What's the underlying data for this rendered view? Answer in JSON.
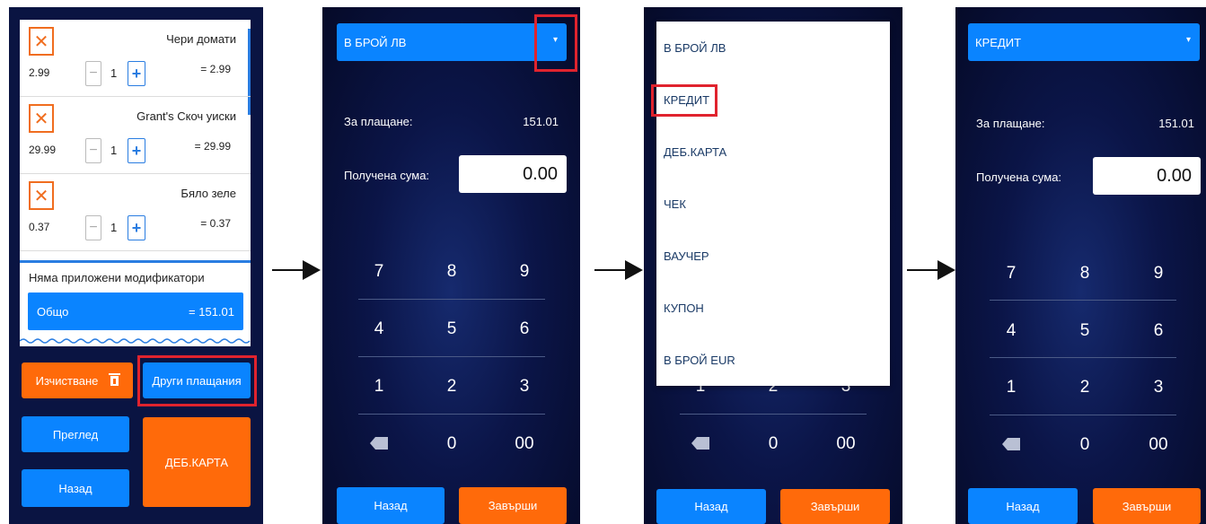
{
  "screen1": {
    "items": [
      {
        "name": "Чери домати",
        "price": "2.99",
        "qty": "1",
        "total": "= 2.99"
      },
      {
        "name": "Grant's Скоч уиски",
        "price": "29.99",
        "qty": "1",
        "total": "= 29.99"
      },
      {
        "name": "Бяло зеле",
        "price": "0.37",
        "qty": "1",
        "total": "= 0.37"
      }
    ],
    "remove_glyph": "✕",
    "minus_glyph": "−",
    "plus_glyph": "+",
    "modifiers_text": "Няма приложени модификатори",
    "total_label": "Общо",
    "total_value": "= 151.01",
    "clear_label": "Изчистване",
    "other_payments_label": "Други плащания",
    "preview_label": "Преглед",
    "back_label": "Назад",
    "debit_card_label": "ДЕБ.КАРТА"
  },
  "screen2": {
    "payment_method": "В БРОЙ ЛВ",
    "to_pay_label": "За плащане:",
    "to_pay_value": "151.01",
    "received_label": "Получена сума:",
    "received_value": "0.00",
    "back_label": "Назад",
    "finish_label": "Завърши"
  },
  "screen3": {
    "options": [
      "В БРОЙ ЛВ",
      "КРЕДИТ",
      "ДЕБ.КАРТА",
      "ЧЕК",
      "ВАУЧЕР",
      "КУПОН",
      "В БРОЙ EUR"
    ],
    "back_label": "Назад",
    "finish_label": "Завърши"
  },
  "screen4": {
    "payment_method": "КРЕДИТ",
    "to_pay_label": "За плащане:",
    "to_pay_value": "151.01",
    "received_label": "Получена сума:",
    "received_value": "0.00",
    "back_label": "Назад",
    "finish_label": "Завърши"
  },
  "keypad": {
    "keys": [
      "7",
      "8",
      "9",
      "4",
      "5",
      "6",
      "1",
      "2",
      "3",
      "0",
      "00"
    ]
  },
  "icons": {
    "dropdown_chevron": "▾"
  },
  "colors": {
    "accent_blue": "#0a84ff",
    "accent_orange": "#ff6a0a",
    "highlight_red": "#e0232e",
    "background_navy": "#0b1548"
  }
}
